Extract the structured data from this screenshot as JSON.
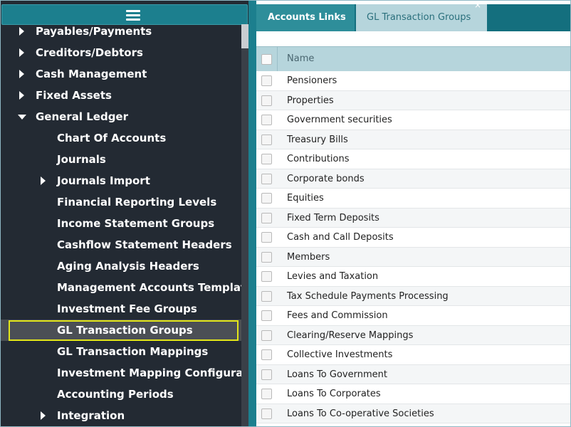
{
  "sidebar": {
    "menu_icon": "hamburger-icon",
    "items": [
      {
        "label": "Payables/Payments",
        "level": 1,
        "arrow": "right"
      },
      {
        "label": "Creditors/Debtors",
        "level": 1,
        "arrow": "right"
      },
      {
        "label": "Cash Management",
        "level": 1,
        "arrow": "right"
      },
      {
        "label": "Fixed Assets",
        "level": 1,
        "arrow": "right"
      },
      {
        "label": "General Ledger",
        "level": 1,
        "arrow": "down"
      },
      {
        "label": "Chart Of Accounts",
        "level": 2
      },
      {
        "label": "Journals",
        "level": 2
      },
      {
        "label": "Journals Import",
        "level": 2,
        "arrow": "right"
      },
      {
        "label": "Financial Reporting Levels",
        "level": 2
      },
      {
        "label": "Income Statement Groups",
        "level": 2
      },
      {
        "label": "Cashflow Statement Headers",
        "level": 2
      },
      {
        "label": "Aging Analysis Headers",
        "level": 2
      },
      {
        "label": "Management Accounts Templates",
        "level": 2
      },
      {
        "label": "Investment Fee Groups",
        "level": 2
      },
      {
        "label": "GL Transaction Groups",
        "level": 2,
        "selected": true
      },
      {
        "label": "GL Transaction Mappings",
        "level": 2
      },
      {
        "label": "Investment Mapping Configuration",
        "level": 2
      },
      {
        "label": "Accounting Periods",
        "level": 2
      },
      {
        "label": "Integration",
        "level": 2,
        "arrow": "right"
      }
    ]
  },
  "tabs": [
    {
      "label": "Accounts Links",
      "active": false
    },
    {
      "label": "GL Transaction Groups",
      "active": true,
      "close": "×"
    }
  ],
  "table": {
    "header": "Name",
    "rows": [
      "Pensioners",
      "Properties",
      "Government securities",
      "Treasury Bills",
      "Contributions",
      "Corporate bonds",
      "Equities",
      "Fixed Term Deposits",
      "Cash and Call Deposits",
      "Members",
      "Levies and Taxation",
      "Tax Schedule Payments Processing",
      "Fees and Commission",
      "Clearing/Reserve Mappings",
      "Collective Investments",
      "Loans To Government",
      "Loans To Corporates",
      "Loans To Co-operative Societies"
    ]
  },
  "colors": {
    "sidebar_bg": "#232a33",
    "accent_teal": "#1c7f8e",
    "highlight_border": "#e3e619",
    "header_bg": "#b6d5dc"
  }
}
